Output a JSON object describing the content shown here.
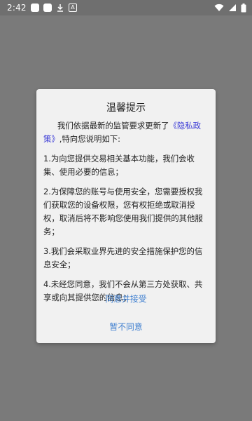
{
  "status_bar": {
    "time": "2:42",
    "notification_icons": [
      "app-icon",
      "app-icon",
      "download-icon",
      "a-icon"
    ],
    "system_icons": [
      "wifi-icon",
      "signal-icon",
      "battery-icon"
    ]
  },
  "dialog": {
    "title": "温馨提示",
    "intro_text": "我们依据最新的监管要求更新了",
    "policy_link": "《隐私政策》",
    "intro_suffix": ",特向您说明如下:",
    "items": [
      "1.为向您提供交易相关基本功能，我们会收集、使用必要的信息；",
      "2.为保障您的账号与使用安全，您需要授权我们获取您的设备权限，您有权拒绝或取消授权，取消后将不影响您使用我们提供的其他服务；",
      "3.我们会采取业界先进的安全措施保护您的信息安全；",
      "4.未经您同意，我们不会从第三方处获取、共享或向其提供您的信息；"
    ],
    "accept_label": "同意并接受",
    "reject_label": "暂不同意"
  },
  "colors": {
    "overlay": "#7a7a7a",
    "dialog_bg": "#f1f1f1",
    "link": "#3a3ad6",
    "button_text": "#3f7fd0"
  }
}
